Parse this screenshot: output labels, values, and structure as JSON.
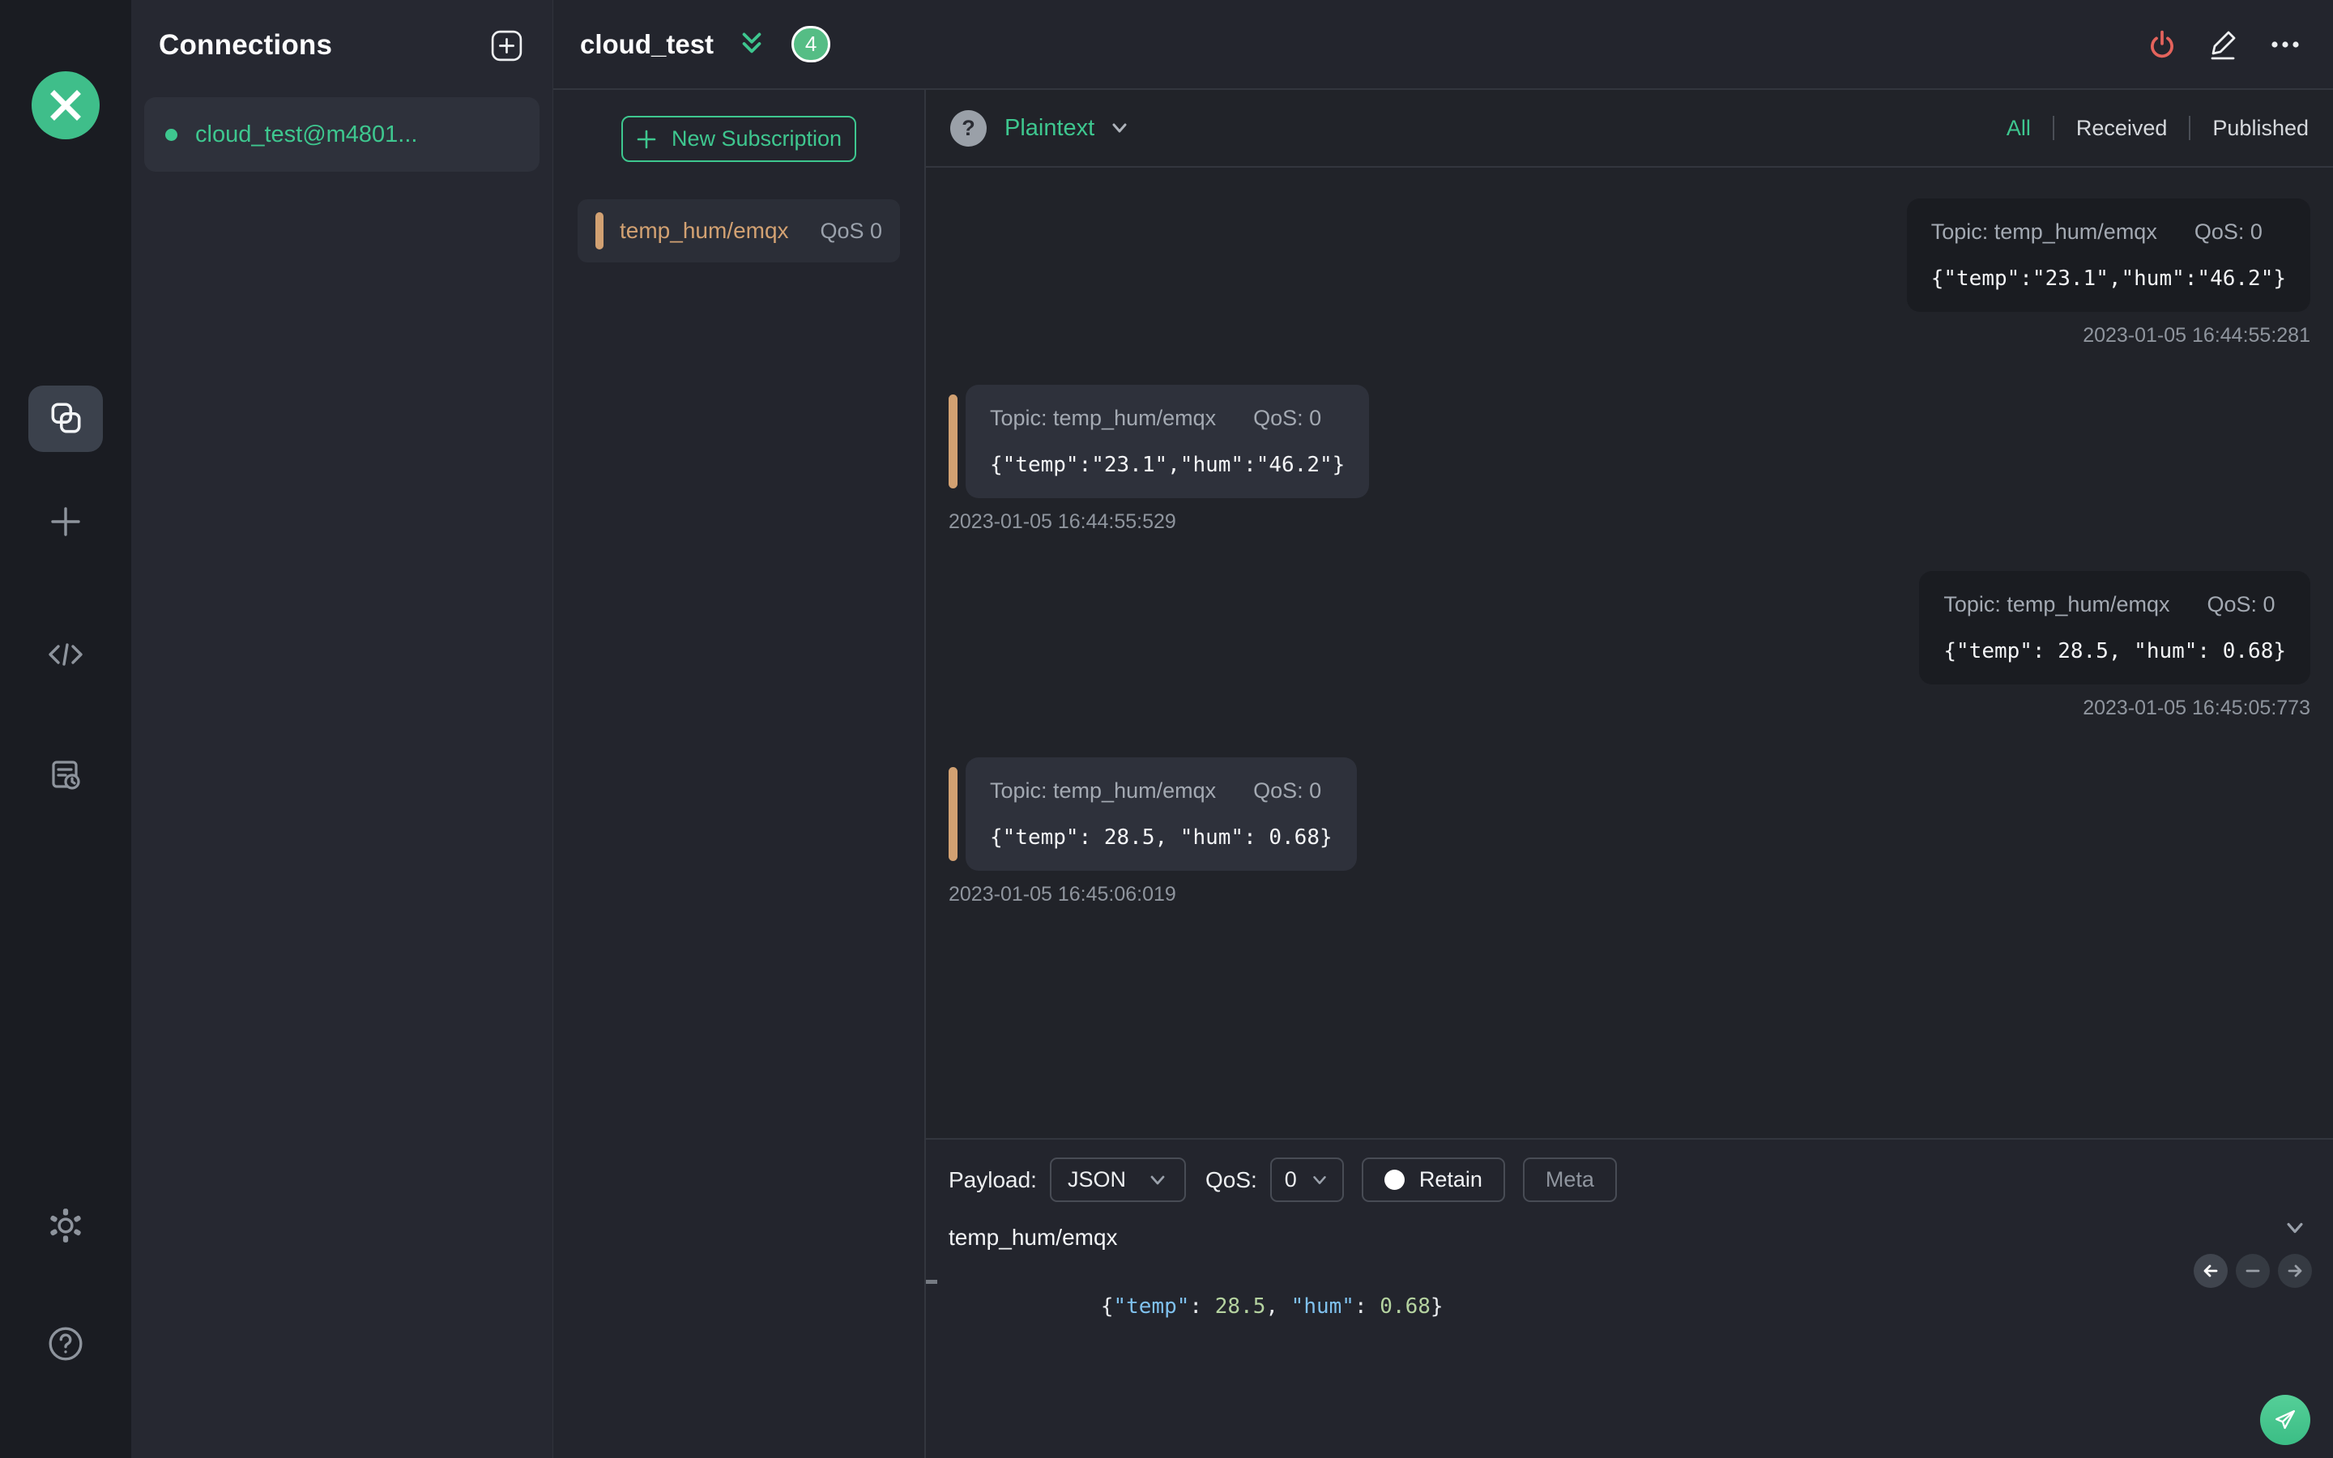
{
  "colors": {
    "accent_green": "#3ec78f",
    "topic_tan": "#d2a172",
    "disconnect_red": "#e4635c"
  },
  "navbar": {
    "icons": [
      "mqttx-logo",
      "connections",
      "new-connection",
      "script",
      "log",
      "settings",
      "help"
    ]
  },
  "connections_panel": {
    "title": "Connections",
    "add_icon": "plus-square",
    "items": [
      {
        "name": "cloud_test@m4801...",
        "status": "connected"
      }
    ]
  },
  "topbar": {
    "title": "cloud_test",
    "collapse_icon": "double-chevron-down",
    "message_count": "4",
    "action_icons": [
      "power-disconnect",
      "edit-pencil",
      "ellipsis-more"
    ]
  },
  "subscriptions": {
    "new_button_label": "New Subscription",
    "items": [
      {
        "topic": "temp_hum/emqx",
        "qos": "QoS 0"
      }
    ]
  },
  "messages_header": {
    "help_glyph": "?",
    "format": "Plaintext",
    "tabs": [
      {
        "label": "All",
        "active": true
      },
      {
        "label": "Received",
        "active": false
      },
      {
        "label": "Published",
        "active": false
      }
    ]
  },
  "messages": {
    "items": [
      {
        "side": "right",
        "topic_label": "Topic: temp_hum/emqx",
        "qos_label": "QoS: 0",
        "payload": "{\"temp\":\"23.1\",\"hum\":\"46.2\"}",
        "timestamp": "2023-01-05 16:44:55:281"
      },
      {
        "side": "left",
        "topic_label": "Topic: temp_hum/emqx",
        "qos_label": "QoS: 0",
        "payload": "{\"temp\":\"23.1\",\"hum\":\"46.2\"}",
        "timestamp": "2023-01-05 16:44:55:529"
      },
      {
        "side": "right",
        "topic_label": "Topic: temp_hum/emqx",
        "qos_label": "QoS: 0",
        "payload": "{\"temp\": 28.5, \"hum\": 0.68}",
        "timestamp": "2023-01-05 16:45:05:773"
      },
      {
        "side": "left",
        "topic_label": "Topic: temp_hum/emqx",
        "qos_label": "QoS: 0",
        "payload": "{\"temp\": 28.5, \"hum\": 0.68}",
        "timestamp": "2023-01-05 16:45:06:019"
      }
    ]
  },
  "publish": {
    "payload_label": "Payload:",
    "payload_format": "JSON",
    "qos_label": "QoS:",
    "qos_value": "0",
    "retain_label": "Retain",
    "meta_label": "Meta",
    "topic_value": "temp_hum/emqx",
    "payload_value": "{\"temp\": 28.5, \"hum\": 0.68}",
    "editor_tokens": {
      "t0": "{",
      "t1": "\"temp\"",
      "t2": ": ",
      "t3": "28.5",
      "t4": ", ",
      "t5": "\"hum\"",
      "t6": ": ",
      "t7": "0.68",
      "t8": "}"
    }
  }
}
